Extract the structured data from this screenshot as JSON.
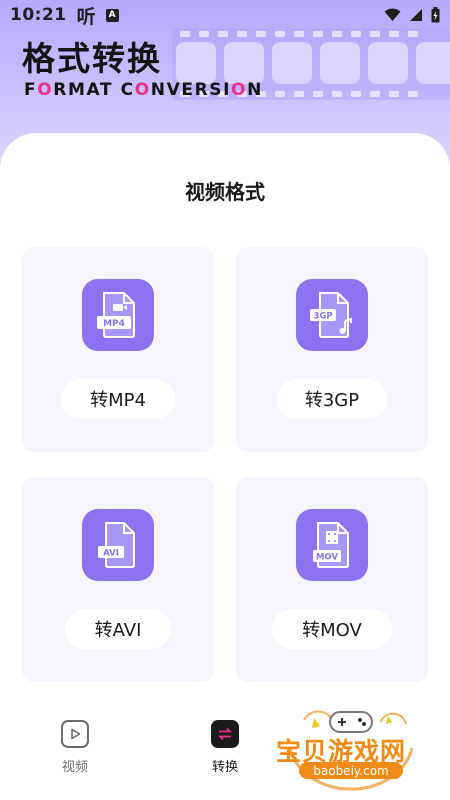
{
  "status_bar": {
    "time": "10:21",
    "ting_glyph": "听",
    "a_badge": "A",
    "icons": [
      "wifi-icon",
      "signal-icon",
      "battery-icon"
    ]
  },
  "header": {
    "title": "格式转换",
    "subtitle_parts": [
      "F",
      "O",
      "RMAT C",
      "O",
      "NVERSI",
      "O",
      "N"
    ]
  },
  "section": {
    "title": "视频格式"
  },
  "formats": [
    {
      "icon_label": "MP4",
      "button": "转MP4",
      "icon": "video-file-icon"
    },
    {
      "icon_label": "3GP",
      "button": "转3GP",
      "icon": "audio-file-icon"
    },
    {
      "icon_label": "AVI",
      "button": "转AVI",
      "icon": "file-icon"
    },
    {
      "icon_label": "MOV",
      "button": "转MOV",
      "icon": "film-file-icon"
    }
  ],
  "bottom_nav": {
    "items": [
      {
        "label": "视频",
        "icon": "play-icon",
        "active": false
      },
      {
        "label": "转换",
        "icon": "convert-icon",
        "active": true
      }
    ]
  },
  "watermark": {
    "text": "宝贝游戏网",
    "url": "baobeiy.com"
  },
  "colors": {
    "accent": "#8b72f0",
    "header_gradient_top": "#b7a7fb",
    "card_bg": "#f4f5fd",
    "pink": "#e6338e",
    "watermark": "#f08a16"
  }
}
